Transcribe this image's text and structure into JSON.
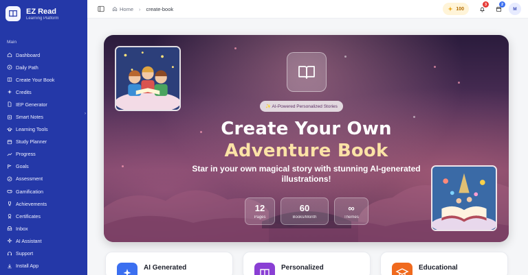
{
  "brand": {
    "name": "EZ Read",
    "subtitle": "Learning Platform"
  },
  "sidebar": {
    "section": "Main",
    "items": [
      {
        "label": "Dashboard",
        "icon": "home-icon"
      },
      {
        "label": "Daily Path",
        "icon": "compass-icon"
      },
      {
        "label": "Create Your Book",
        "icon": "book-icon"
      },
      {
        "label": "Credits",
        "icon": "sparkle-icon"
      },
      {
        "label": "IEP Generator",
        "icon": "document-icon"
      },
      {
        "label": "Smart Notes",
        "icon": "notes-icon"
      },
      {
        "label": "Learning Tools",
        "icon": "graduation-cap-icon"
      },
      {
        "label": "Study Planner",
        "icon": "calendar-icon"
      },
      {
        "label": "Progress",
        "icon": "trend-icon"
      },
      {
        "label": "Goals",
        "icon": "target-icon"
      },
      {
        "label": "Assessment",
        "icon": "checklist-icon"
      },
      {
        "label": "Gamification",
        "icon": "gamepad-icon"
      },
      {
        "label": "Achievements",
        "icon": "trophy-icon"
      },
      {
        "label": "Certificates",
        "icon": "certificate-icon"
      },
      {
        "label": "Inbox",
        "icon": "inbox-icon"
      },
      {
        "label": "AI Assistant",
        "icon": "bot-icon"
      },
      {
        "label": "Support",
        "icon": "headset-icon"
      },
      {
        "label": "Install App",
        "icon": "download-icon"
      }
    ]
  },
  "topbar": {
    "breadcrumb": {
      "home": "Home",
      "current": "create-book"
    },
    "credits": "100",
    "notifications_count": "3",
    "calendar_count": "2",
    "avatar_initial": "M"
  },
  "hero": {
    "pill": "✨ AI-Powered Personalized Stories",
    "title_line1": "Create Your Own",
    "title_line2": "Adventure Book",
    "subtitle": "Star in your own magical story with stunning AI-generated illustrations!",
    "stats": [
      {
        "value": "12",
        "label": "Pages"
      },
      {
        "value": "60",
        "label": "Books/Month"
      },
      {
        "value": "∞",
        "label": "Themes"
      }
    ]
  },
  "features": [
    {
      "title": "AI Generated",
      "color": "#3b6ff0"
    },
    {
      "title": "Personalized",
      "color": "#8a3fd4"
    },
    {
      "title": "Educational",
      "color": "#f06a1e"
    }
  ],
  "colors": {
    "sidebar": "#2438a8",
    "accent": "#fbe2a6"
  }
}
